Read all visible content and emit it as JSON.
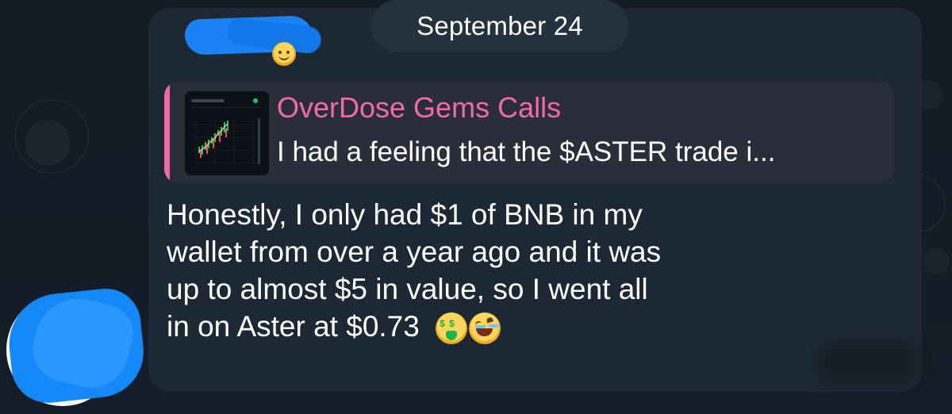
{
  "date_separator": {
    "label": "September 24"
  },
  "reply_preview": {
    "title": "OverDose Gems Calls",
    "snippet": "I had a feeling that the $ASTER trade i..."
  },
  "message": {
    "lines": [
      "Honestly, I only had $1 of BNB in my",
      "wallet from over a year ago and it was",
      "up to almost $5 in value, so I went all",
      "in on Aster at $0.73"
    ]
  },
  "icons": {
    "sender_reaction": "smiling-emoji-icon",
    "money_mouth": "money-mouth-face-icon",
    "rofl": "rolling-on-floor-laughing-icon",
    "avatar": "avatar-icon"
  },
  "colors": {
    "background": "#121b24",
    "bubble": "#1c2833",
    "reply_card": "#2a2e3a",
    "reply_accent": "#f267a3",
    "text_primary": "#ffffff",
    "redaction": "#1588f7"
  }
}
